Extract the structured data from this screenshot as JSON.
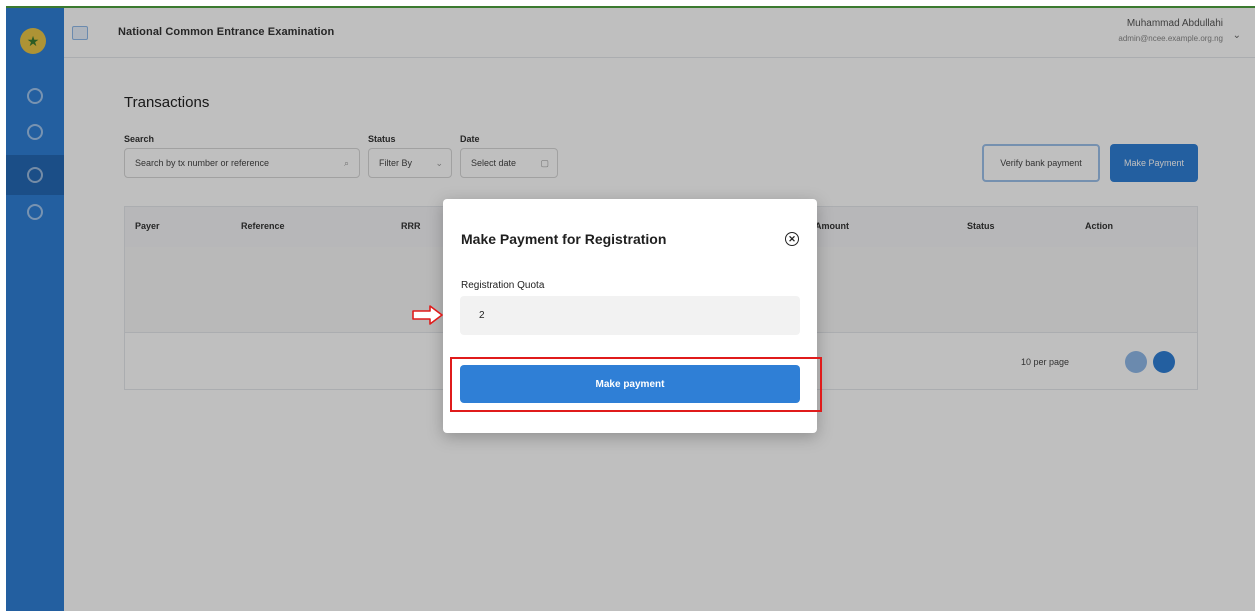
{
  "app": {
    "title": "National Common Entrance Examination",
    "user_name": "Muhammad Abdullahi",
    "user_email": "admin@ncee.example.org.ng"
  },
  "sidebar": {
    "items": [
      {
        "icon": "home-icon"
      },
      {
        "icon": "users-icon"
      },
      {
        "icon": "transactions-icon"
      },
      {
        "icon": "settings-icon"
      }
    ],
    "active_index": 2
  },
  "page": {
    "title": "Transactions",
    "filters": {
      "search_label": "Search",
      "search_placeholder": "Search by tx number or reference",
      "status_label": "Status",
      "status_value": "Filter By",
      "date_label": "Date",
      "date_value": "Select date"
    },
    "actions": {
      "verify_label": "Verify bank payment",
      "make_payment_label": "Make Payment"
    },
    "table": {
      "columns": [
        "Payer",
        "Reference",
        "RRR",
        "",
        "Amount",
        "Status",
        "Action"
      ],
      "rows_per_page": "10 per page"
    }
  },
  "modal": {
    "title": "Make Payment for Registration",
    "field_label": "Registration Quota",
    "field_value": "2",
    "submit_label": "Make payment"
  },
  "colors": {
    "primary": "#2f7fd6",
    "highlight": "#e01b1b",
    "sidebar": "#2f7fd6"
  }
}
